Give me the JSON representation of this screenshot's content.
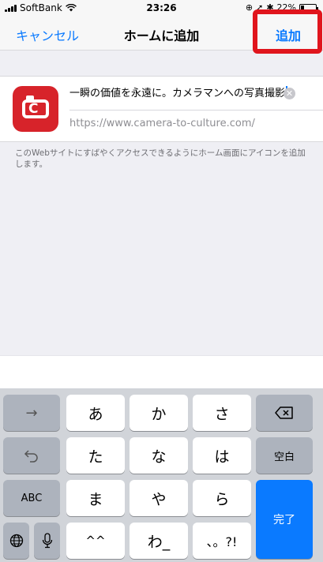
{
  "status_bar": {
    "carrier": "SoftBank",
    "time": "23:26",
    "battery_text": "22%",
    "battery_level": 0.22
  },
  "nav": {
    "cancel_label": "キャンセル",
    "title": "ホームに追加",
    "add_label": "追加",
    "highlight_color": "#e0151d",
    "accent_color": "#0a7aff"
  },
  "form": {
    "name_value": "一瞬の価値を永遠に。カメラマンへの写真撮影",
    "url_value": "https://www.camera-to-culture.com/",
    "app_icon": "camera-app-icon",
    "app_icon_letter": "C",
    "clear_icon": "clear-circle-icon",
    "hint": "このWebサイトにすばやくアクセスできるようにホーム画面にアイコンを追加します。"
  },
  "keyboard": {
    "arrow_key": "→",
    "undo_icon": "undo-icon",
    "abc_key": "ABC",
    "globe_icon": "globe-icon",
    "mic_icon": "microphone-icon",
    "delete_icon": "delete-icon",
    "keys": {
      "a": "あ",
      "ka": "か",
      "sa": "さ",
      "ta": "た",
      "na": "な",
      "ha": "は",
      "ma": "ま",
      "ya": "や",
      "ra": "ら",
      "dakuten": "^^",
      "wa": "わ_",
      "punct": "、。?!"
    },
    "space_key": "空白",
    "done_key": "完了"
  }
}
